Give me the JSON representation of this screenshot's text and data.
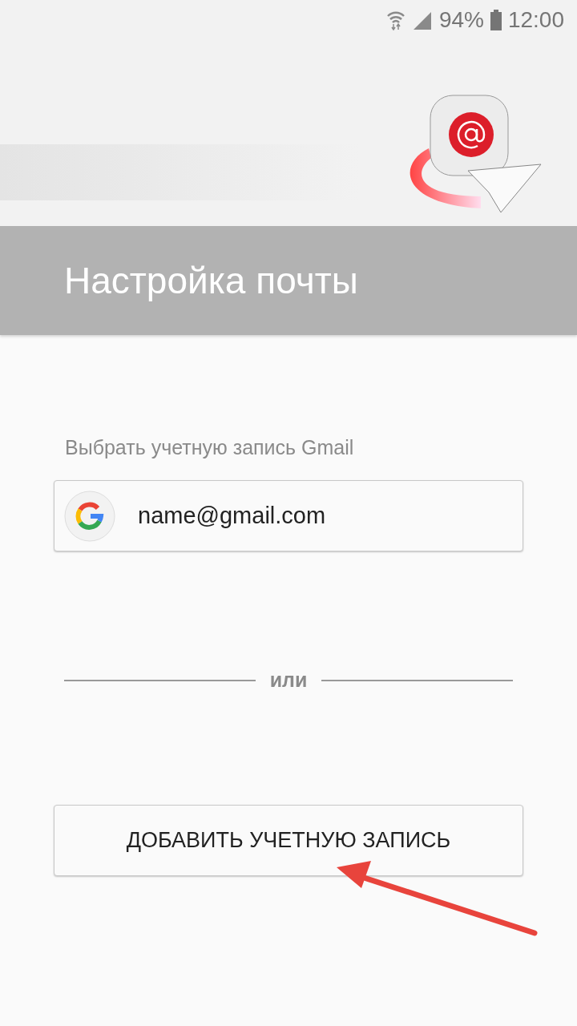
{
  "status_bar": {
    "battery": "94%",
    "time": "12:00"
  },
  "header": {
    "title": "Настройка почты"
  },
  "gmail_section": {
    "label": "Выбрать учетную запись Gmail",
    "accounts": [
      {
        "email": "name@gmail.com"
      }
    ]
  },
  "divider": {
    "text": "или"
  },
  "add_button": {
    "label": "ДОБАВИТЬ УЧЕТНУЮ ЗАПИСЬ"
  }
}
